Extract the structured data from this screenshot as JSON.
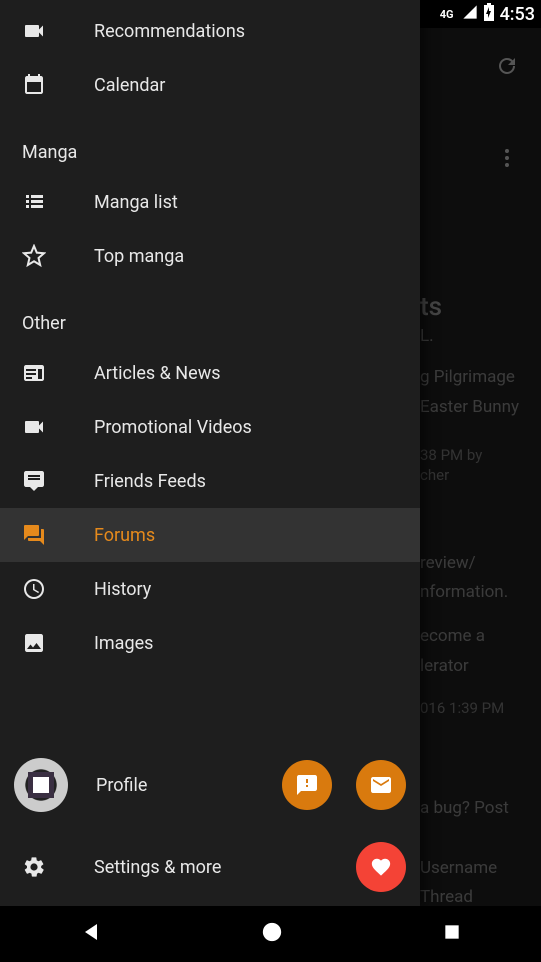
{
  "status": {
    "network": "4G",
    "time": "4:53"
  },
  "drawer": {
    "items": {
      "recommendations": "Recommendations",
      "calendar": "Calendar",
      "manga_list": "Manga list",
      "top_manga": "Top manga",
      "articles": "Articles & News",
      "promo": "Promotional Videos",
      "friends": "Friends Feeds",
      "forums": "Forums",
      "history": "History",
      "images": "Images"
    },
    "sections": {
      "manga": "Manga",
      "other": "Other"
    },
    "profile": "Profile",
    "settings": "Settings & more"
  },
  "bg": {
    "title_part": "ts",
    "sub": "L.",
    "item1a": "g Pilgrimage",
    "item1b": "Easter Bunny",
    "meta1a": "38 PM by",
    "meta1b": "cher",
    "item2a": "review/",
    "item2b": "nformation.",
    "item3a": "ecome a",
    "item3b": "lerator",
    "meta2": "016 1:39 PM",
    "item4": "a bug? Post",
    "item5a": "Username",
    "item5b": "Thread"
  }
}
